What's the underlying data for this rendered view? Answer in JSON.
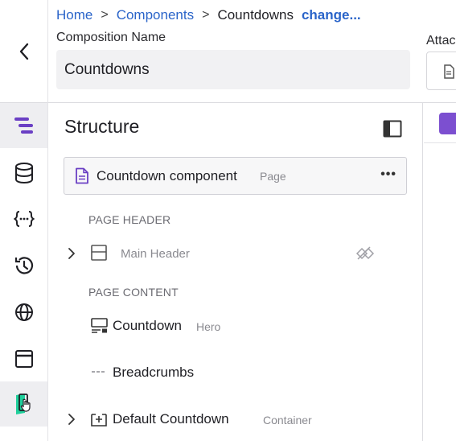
{
  "breadcrumb": {
    "home": "Home",
    "components": "Components",
    "current": "Countdowns",
    "change": "change..."
  },
  "composition": {
    "label": "Composition Name",
    "value": "Countdowns"
  },
  "attach": {
    "label": "Attac"
  },
  "rail": {
    "items": [
      {
        "icon": "structure-icon",
        "active": true
      },
      {
        "icon": "database-icon"
      },
      {
        "icon": "braces-icon"
      },
      {
        "icon": "history-icon"
      },
      {
        "icon": "globe-icon"
      },
      {
        "icon": "browser-window-icon"
      },
      {
        "icon": "mobile-preview-icon"
      }
    ]
  },
  "structure": {
    "title": "Structure",
    "root": {
      "name": "Countdown component",
      "type": "Page"
    },
    "sections": [
      {
        "label": "PAGE HEADER",
        "items": [
          {
            "name": "Main Header",
            "type": "",
            "hidden": true,
            "expandable": true
          }
        ]
      },
      {
        "label": "PAGE CONTENT",
        "items": [
          {
            "name": "Countdown",
            "type": "Hero",
            "expandable": false
          },
          {
            "name": "Breadcrumbs",
            "type": "",
            "expandable": false
          },
          {
            "name": "Default Countdown",
            "type": "Container",
            "expandable": true
          }
        ]
      }
    ]
  },
  "colors": {
    "accent": "#6a3fc4",
    "link": "#2a64c9",
    "muted": "#8a8a90"
  }
}
